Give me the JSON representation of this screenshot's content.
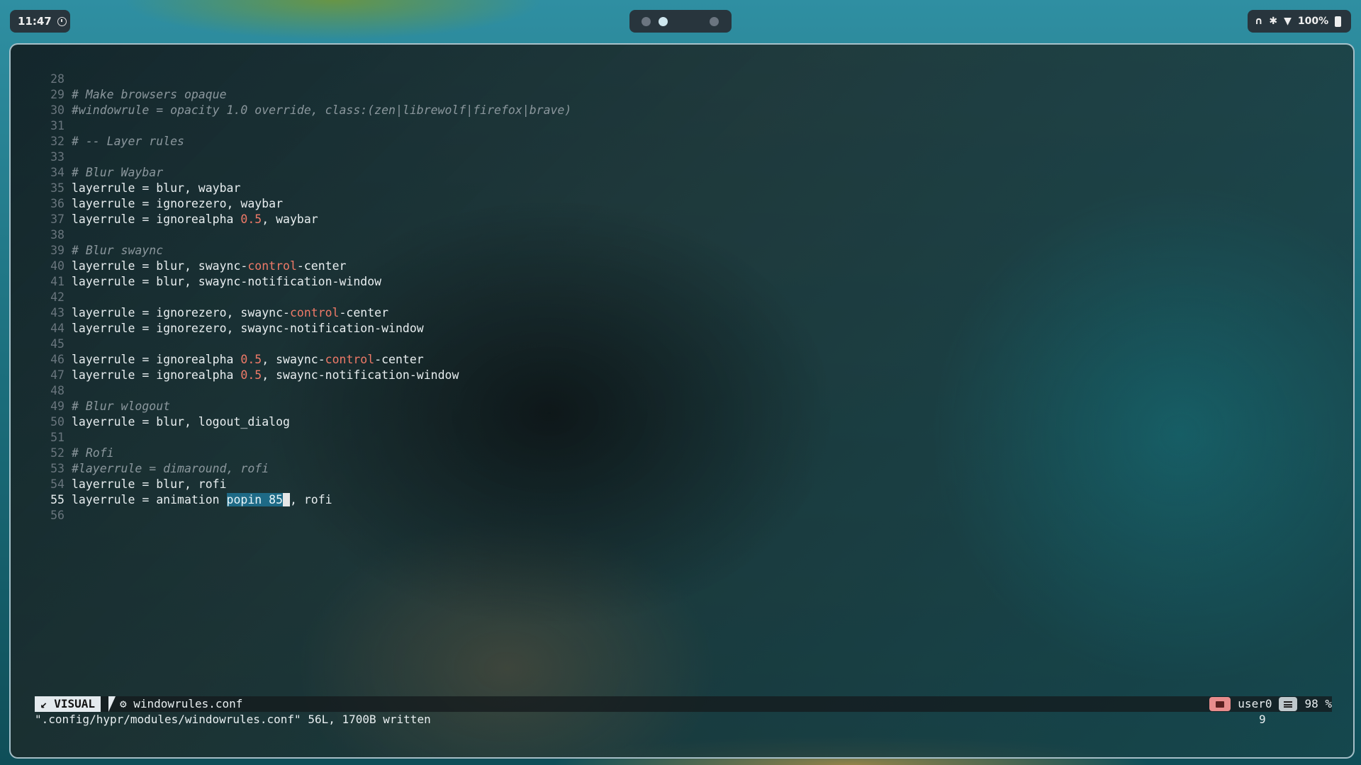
{
  "topbar": {
    "clock": "11:47",
    "workspaces": [
      {
        "active": false
      },
      {
        "active": true
      },
      {
        "active": false
      }
    ],
    "status": {
      "icons": [
        "headphones-icon",
        "bluetooth-icon",
        "wifi-icon",
        "battery-icon"
      ],
      "battery": "100%"
    }
  },
  "editor": {
    "lines": [
      {
        "n": "28",
        "segments": []
      },
      {
        "n": "29",
        "segments": [
          {
            "t": "# Make browsers opaque",
            "c": "comment"
          }
        ]
      },
      {
        "n": "30",
        "segments": [
          {
            "t": "#windowrule = opacity 1.0 override, class:(zen|librewolf|firefox|brave)",
            "c": "comment"
          }
        ]
      },
      {
        "n": "31",
        "segments": []
      },
      {
        "n": "32",
        "segments": [
          {
            "t": "# -- Layer rules",
            "c": "comment"
          }
        ]
      },
      {
        "n": "33",
        "segments": []
      },
      {
        "n": "34",
        "segments": [
          {
            "t": "# Blur Waybar",
            "c": "comment"
          }
        ]
      },
      {
        "n": "35",
        "segments": [
          {
            "t": "layerrule = blur, waybar",
            "c": ""
          }
        ]
      },
      {
        "n": "36",
        "segments": [
          {
            "t": "layerrule = ignorezero, waybar",
            "c": ""
          }
        ]
      },
      {
        "n": "37",
        "segments": [
          {
            "t": "layerrule = ignorealpha ",
            "c": ""
          },
          {
            "t": "0.5",
            "c": "num"
          },
          {
            "t": ", waybar",
            "c": ""
          }
        ]
      },
      {
        "n": "38",
        "segments": []
      },
      {
        "n": "39",
        "segments": [
          {
            "t": "# Blur swaync",
            "c": "comment"
          }
        ]
      },
      {
        "n": "40",
        "segments": [
          {
            "t": "layerrule = blur, swaync-",
            "c": ""
          },
          {
            "t": "control",
            "c": "kw"
          },
          {
            "t": "-center",
            "c": ""
          }
        ]
      },
      {
        "n": "41",
        "segments": [
          {
            "t": "layerrule = blur, swaync-notification-window",
            "c": ""
          }
        ]
      },
      {
        "n": "42",
        "segments": []
      },
      {
        "n": "43",
        "segments": [
          {
            "t": "layerrule = ignorezero, swaync-",
            "c": ""
          },
          {
            "t": "control",
            "c": "kw"
          },
          {
            "t": "-center",
            "c": ""
          }
        ]
      },
      {
        "n": "44",
        "segments": [
          {
            "t": "layerrule = ignorezero, swaync-notification-window",
            "c": ""
          }
        ]
      },
      {
        "n": "45",
        "segments": []
      },
      {
        "n": "46",
        "segments": [
          {
            "t": "layerrule = ignorealpha ",
            "c": ""
          },
          {
            "t": "0.5",
            "c": "num"
          },
          {
            "t": ", swaync-",
            "c": ""
          },
          {
            "t": "control",
            "c": "kw"
          },
          {
            "t": "-center",
            "c": ""
          }
        ]
      },
      {
        "n": "47",
        "segments": [
          {
            "t": "layerrule = ignorealpha ",
            "c": ""
          },
          {
            "t": "0.5",
            "c": "num"
          },
          {
            "t": ", swaync-notification-window",
            "c": ""
          }
        ]
      },
      {
        "n": "48",
        "segments": []
      },
      {
        "n": "49",
        "segments": [
          {
            "t": "# Blur wlogout",
            "c": "comment"
          }
        ]
      },
      {
        "n": "50",
        "segments": [
          {
            "t": "layerrule = blur, logout_dialog",
            "c": ""
          }
        ]
      },
      {
        "n": "51",
        "segments": []
      },
      {
        "n": "52",
        "segments": [
          {
            "t": "# Rofi",
            "c": "comment"
          }
        ]
      },
      {
        "n": "53",
        "segments": [
          {
            "t": "#layerrule = dimaround, rofi",
            "c": "comment"
          }
        ]
      },
      {
        "n": "54",
        "segments": [
          {
            "t": "layerrule = blur, rofi",
            "c": ""
          }
        ]
      },
      {
        "n": "55",
        "current": true,
        "segments": [
          {
            "t": "layerrule = animation ",
            "c": ""
          },
          {
            "t": "popin 85",
            "c": "sel"
          },
          {
            "t": " ",
            "c": "cursor"
          },
          {
            "t": ", rofi",
            "c": ""
          }
        ]
      },
      {
        "n": "56",
        "segments": []
      }
    ]
  },
  "statusline": {
    "mode": "VISUAL",
    "mode_icon": "visual-mode-icon",
    "file_icon": "gear-icon",
    "filename": "windowrules.conf",
    "user": "user0",
    "percent": "98 %"
  },
  "message": {
    "text": "\".config/hypr/modules/windowrules.conf\" 56L, 1700B written",
    "right": "9"
  }
}
